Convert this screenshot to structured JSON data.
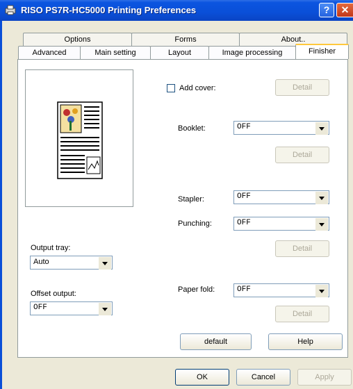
{
  "window": {
    "title": "RISO PS7R-HC5000 Printing Preferences",
    "help_glyph": "?",
    "close_glyph": "✕"
  },
  "tabs": {
    "row1": [
      "Options",
      "Forms",
      "About.."
    ],
    "row2": [
      "Advanced",
      "Main setting",
      "Layout",
      "Image processing",
      "Finisher"
    ],
    "active": "Finisher"
  },
  "finisher": {
    "add_cover_label": "Add cover:",
    "add_cover_checked": false,
    "detail_label": "Detail",
    "booklet": {
      "label": "Booklet:",
      "value": "OFF"
    },
    "stapler": {
      "label": "Stapler:",
      "value": "OFF"
    },
    "punching": {
      "label": "Punching:",
      "value": "OFF"
    },
    "paper_fold": {
      "label": "Paper fold:",
      "value": "OFF"
    },
    "output_tray": {
      "label": "Output tray:",
      "value": "Auto"
    },
    "offset_output": {
      "label": "Offset output:",
      "value": "OFF"
    },
    "default_label": "default",
    "help_label": "Help"
  },
  "footer": {
    "ok": "OK",
    "cancel": "Cancel",
    "apply": "Apply"
  }
}
